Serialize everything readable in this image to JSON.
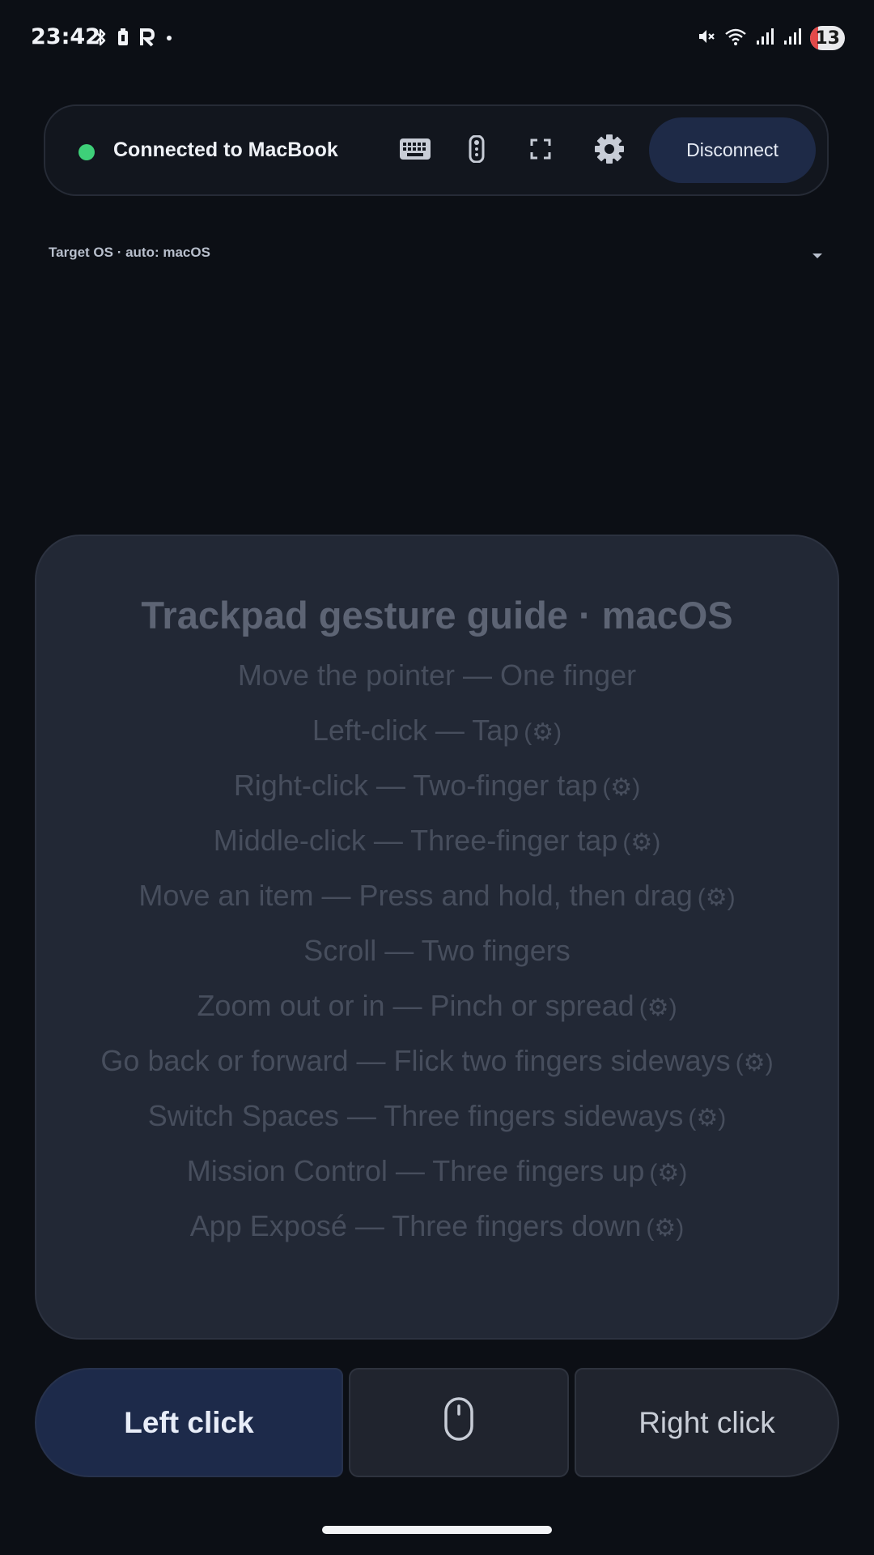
{
  "status_bar": {
    "time": "23:42",
    "left_icons": [
      "bluetooth-icon",
      "battery-saver-icon",
      "r-app-icon",
      "dot-icon"
    ],
    "right_icons": [
      "mute-icon",
      "wifi-icon",
      "signal-icon",
      "signal-icon-2"
    ],
    "battery_level": "13"
  },
  "connection": {
    "status_text": "Connected to MacBook",
    "status_color": "#3ed079",
    "tools": [
      "keyboard-icon",
      "remote-icon",
      "fullscreen-icon",
      "gear-icon"
    ],
    "disconnect_label": "Disconnect"
  },
  "target_os": {
    "label": "Target OS · auto: macOS"
  },
  "gesture_guide": {
    "title": "Trackpad gesture guide · macOS",
    "gear_glyph": "(⚙)",
    "items": [
      {
        "text": "Move the pointer — One finger",
        "configurable": false
      },
      {
        "text": "Left-click — Tap",
        "configurable": true
      },
      {
        "text": "Right-click — Two-finger tap",
        "configurable": true
      },
      {
        "text": "Middle-click — Three-finger tap",
        "configurable": true
      },
      {
        "text": "Move an item — Press and hold, then drag",
        "configurable": true
      },
      {
        "text": "Scroll — Two fingers",
        "configurable": false
      },
      {
        "text": "Zoom out or in — Pinch or spread",
        "configurable": true
      },
      {
        "text": "Go back or forward — Flick two fingers sideways",
        "configurable": true
      },
      {
        "text": "Switch Spaces — Three fingers sideways",
        "configurable": true
      },
      {
        "text": "Mission Control — Three fingers up",
        "configurable": true
      },
      {
        "text": "App Exposé — Three fingers down",
        "configurable": true
      }
    ]
  },
  "buttons": {
    "left_click": "Left click",
    "middle_icon": "mouse-icon",
    "right_click": "Right click"
  },
  "colors": {
    "background": "#0c0f15",
    "accent": "#1e2a47"
  }
}
